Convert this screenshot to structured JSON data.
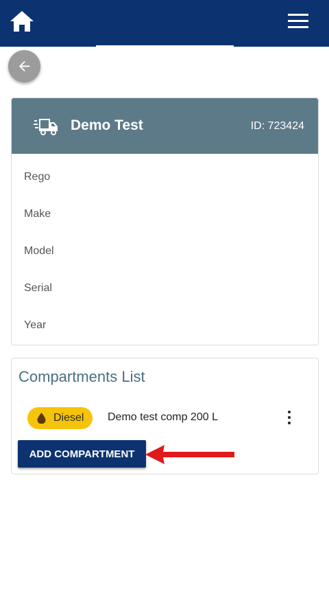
{
  "colors": {
    "topbar": "#0c3370",
    "card_header": "#5d7a89",
    "fuel_badge": "#f6c30b",
    "primary_button": "#0c3370",
    "annotation_arrow": "#e0191b"
  },
  "topbar": {
    "home_icon": "home-icon",
    "menu_icon": "hamburger-menu-icon"
  },
  "back_button": {
    "icon": "arrow-left-icon"
  },
  "vehicle": {
    "icon": "truck-icon",
    "name": "Demo Test",
    "id_text": "ID: 723424",
    "fields": [
      "Rego",
      "Make",
      "Model",
      "Serial",
      "Year"
    ]
  },
  "compartments": {
    "title": "Compartments List",
    "items": [
      {
        "fuel_type": "Diesel",
        "fuel_icon": "fuel-drop-icon",
        "name": "Demo test comp 200 L",
        "menu_icon": "more-vertical-icon"
      }
    ],
    "add_button_label": "ADD COMPARTMENT"
  },
  "annotation": {
    "icon": "red-arrow-left"
  }
}
